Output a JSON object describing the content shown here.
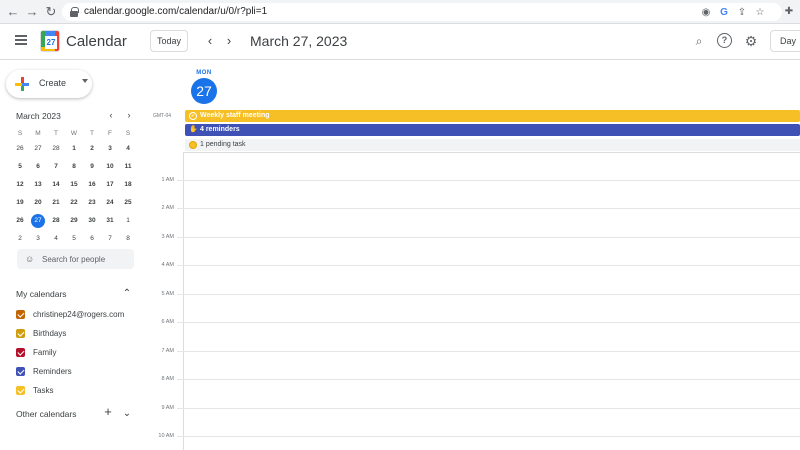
{
  "browser": {
    "back": "←",
    "forward": "→",
    "reload": "↻",
    "url": "calendar.google.com/calendar/u/0/r?pli=1"
  },
  "header": {
    "app_title": "Calendar",
    "logo_number": "27",
    "today_label": "Today",
    "prev": "‹",
    "next": "›",
    "date_title": "March 27, 2023",
    "help": "?",
    "view_label": "Day"
  },
  "sidebar": {
    "create_label": "Create",
    "mini_calendar": {
      "title": "March 2023",
      "prev": "‹",
      "next": "›",
      "weekdays": [
        "S",
        "M",
        "T",
        "W",
        "T",
        "F",
        "S"
      ],
      "weeks": [
        [
          "26",
          "27",
          "28",
          "1",
          "2",
          "3",
          "4"
        ],
        [
          "5",
          "6",
          "7",
          "8",
          "9",
          "10",
          "11"
        ],
        [
          "12",
          "13",
          "14",
          "15",
          "16",
          "17",
          "18"
        ],
        [
          "19",
          "20",
          "21",
          "22",
          "23",
          "24",
          "25"
        ],
        [
          "26",
          "27",
          "28",
          "29",
          "30",
          "31",
          "1"
        ],
        [
          "2",
          "3",
          "4",
          "5",
          "6",
          "7",
          "8"
        ]
      ]
    },
    "search_people_placeholder": "Search for people",
    "my_calendars_title": "My calendars",
    "calendars": [
      {
        "label": "christinep24@rogers.com",
        "color": "#c26401"
      },
      {
        "label": "Birthdays",
        "color": "#cf9c0e"
      },
      {
        "label": "Family",
        "color": "#b3112b"
      },
      {
        "label": "Reminders",
        "color": "#3f51b5"
      },
      {
        "label": "Tasks",
        "color": "#f6bf26"
      }
    ],
    "other_calendars_title": "Other calendars",
    "add": "+"
  },
  "day_view": {
    "dow": "MON",
    "day_number": "27",
    "timezone": "GMT-04",
    "all_day_events": [
      {
        "label": "Weekly staff meeting",
        "color": "#f6bf26"
      },
      {
        "label": "4 reminders",
        "color": "#3f51b5"
      }
    ],
    "pending_task": "1 pending task",
    "hours": [
      "1 AM",
      "2 AM",
      "3 AM",
      "4 AM",
      "5 AM",
      "6 AM",
      "7 AM",
      "8 AM",
      "9 AM",
      "10 AM"
    ]
  },
  "colors": {
    "accent": "#1a73e8"
  }
}
